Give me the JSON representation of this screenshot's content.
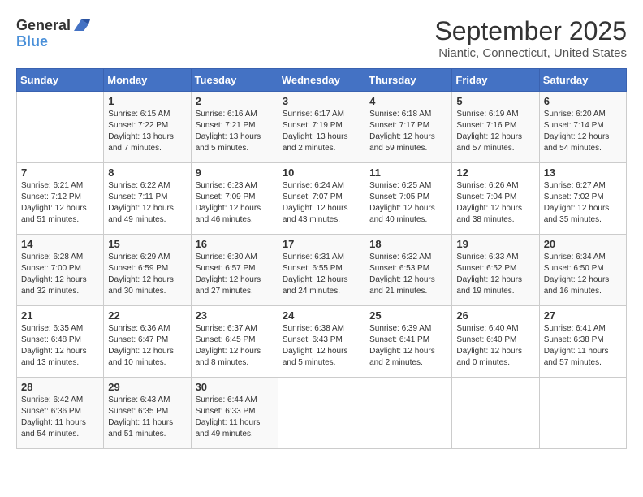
{
  "header": {
    "logo_general": "General",
    "logo_blue": "Blue",
    "month": "September 2025",
    "location": "Niantic, Connecticut, United States"
  },
  "days_of_week": [
    "Sunday",
    "Monday",
    "Tuesday",
    "Wednesday",
    "Thursday",
    "Friday",
    "Saturday"
  ],
  "weeks": [
    [
      {
        "day": "",
        "info": ""
      },
      {
        "day": "1",
        "info": "Sunrise: 6:15 AM\nSunset: 7:22 PM\nDaylight: 13 hours\nand 7 minutes."
      },
      {
        "day": "2",
        "info": "Sunrise: 6:16 AM\nSunset: 7:21 PM\nDaylight: 13 hours\nand 5 minutes."
      },
      {
        "day": "3",
        "info": "Sunrise: 6:17 AM\nSunset: 7:19 PM\nDaylight: 13 hours\nand 2 minutes."
      },
      {
        "day": "4",
        "info": "Sunrise: 6:18 AM\nSunset: 7:17 PM\nDaylight: 12 hours\nand 59 minutes."
      },
      {
        "day": "5",
        "info": "Sunrise: 6:19 AM\nSunset: 7:16 PM\nDaylight: 12 hours\nand 57 minutes."
      },
      {
        "day": "6",
        "info": "Sunrise: 6:20 AM\nSunset: 7:14 PM\nDaylight: 12 hours\nand 54 minutes."
      }
    ],
    [
      {
        "day": "7",
        "info": "Sunrise: 6:21 AM\nSunset: 7:12 PM\nDaylight: 12 hours\nand 51 minutes."
      },
      {
        "day": "8",
        "info": "Sunrise: 6:22 AM\nSunset: 7:11 PM\nDaylight: 12 hours\nand 49 minutes."
      },
      {
        "day": "9",
        "info": "Sunrise: 6:23 AM\nSunset: 7:09 PM\nDaylight: 12 hours\nand 46 minutes."
      },
      {
        "day": "10",
        "info": "Sunrise: 6:24 AM\nSunset: 7:07 PM\nDaylight: 12 hours\nand 43 minutes."
      },
      {
        "day": "11",
        "info": "Sunrise: 6:25 AM\nSunset: 7:05 PM\nDaylight: 12 hours\nand 40 minutes."
      },
      {
        "day": "12",
        "info": "Sunrise: 6:26 AM\nSunset: 7:04 PM\nDaylight: 12 hours\nand 38 minutes."
      },
      {
        "day": "13",
        "info": "Sunrise: 6:27 AM\nSunset: 7:02 PM\nDaylight: 12 hours\nand 35 minutes."
      }
    ],
    [
      {
        "day": "14",
        "info": "Sunrise: 6:28 AM\nSunset: 7:00 PM\nDaylight: 12 hours\nand 32 minutes."
      },
      {
        "day": "15",
        "info": "Sunrise: 6:29 AM\nSunset: 6:59 PM\nDaylight: 12 hours\nand 30 minutes."
      },
      {
        "day": "16",
        "info": "Sunrise: 6:30 AM\nSunset: 6:57 PM\nDaylight: 12 hours\nand 27 minutes."
      },
      {
        "day": "17",
        "info": "Sunrise: 6:31 AM\nSunset: 6:55 PM\nDaylight: 12 hours\nand 24 minutes."
      },
      {
        "day": "18",
        "info": "Sunrise: 6:32 AM\nSunset: 6:53 PM\nDaylight: 12 hours\nand 21 minutes."
      },
      {
        "day": "19",
        "info": "Sunrise: 6:33 AM\nSunset: 6:52 PM\nDaylight: 12 hours\nand 19 minutes."
      },
      {
        "day": "20",
        "info": "Sunrise: 6:34 AM\nSunset: 6:50 PM\nDaylight: 12 hours\nand 16 minutes."
      }
    ],
    [
      {
        "day": "21",
        "info": "Sunrise: 6:35 AM\nSunset: 6:48 PM\nDaylight: 12 hours\nand 13 minutes."
      },
      {
        "day": "22",
        "info": "Sunrise: 6:36 AM\nSunset: 6:47 PM\nDaylight: 12 hours\nand 10 minutes."
      },
      {
        "day": "23",
        "info": "Sunrise: 6:37 AM\nSunset: 6:45 PM\nDaylight: 12 hours\nand 8 minutes."
      },
      {
        "day": "24",
        "info": "Sunrise: 6:38 AM\nSunset: 6:43 PM\nDaylight: 12 hours\nand 5 minutes."
      },
      {
        "day": "25",
        "info": "Sunrise: 6:39 AM\nSunset: 6:41 PM\nDaylight: 12 hours\nand 2 minutes."
      },
      {
        "day": "26",
        "info": "Sunrise: 6:40 AM\nSunset: 6:40 PM\nDaylight: 12 hours\nand 0 minutes."
      },
      {
        "day": "27",
        "info": "Sunrise: 6:41 AM\nSunset: 6:38 PM\nDaylight: 11 hours\nand 57 minutes."
      }
    ],
    [
      {
        "day": "28",
        "info": "Sunrise: 6:42 AM\nSunset: 6:36 PM\nDaylight: 11 hours\nand 54 minutes."
      },
      {
        "day": "29",
        "info": "Sunrise: 6:43 AM\nSunset: 6:35 PM\nDaylight: 11 hours\nand 51 minutes."
      },
      {
        "day": "30",
        "info": "Sunrise: 6:44 AM\nSunset: 6:33 PM\nDaylight: 11 hours\nand 49 minutes."
      },
      {
        "day": "",
        "info": ""
      },
      {
        "day": "",
        "info": ""
      },
      {
        "day": "",
        "info": ""
      },
      {
        "day": "",
        "info": ""
      }
    ]
  ]
}
